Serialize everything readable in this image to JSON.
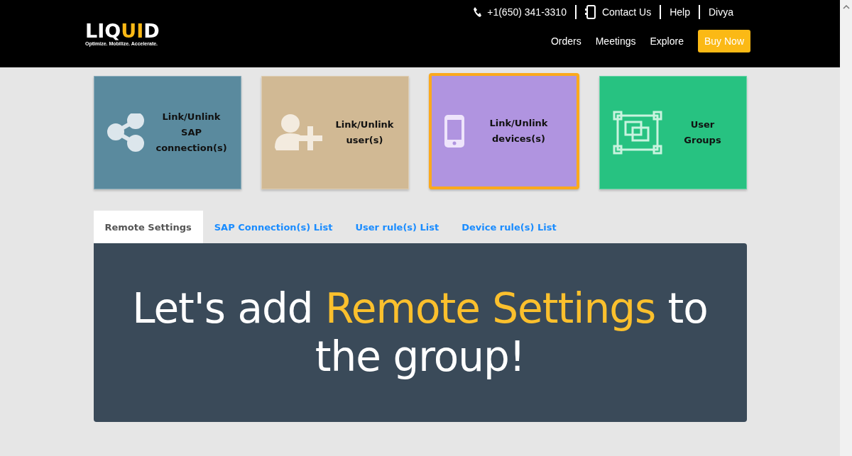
{
  "header": {
    "logo": {
      "word_start": "LIQ",
      "word_accent": "UI",
      "word_end": "D",
      "tagline": "Optimize. Mobilize. Accelerate."
    },
    "top_links": [
      {
        "kind": "phone",
        "label": "+1(650) 341-3310"
      },
      {
        "kind": "contact",
        "label": "Contact Us"
      },
      {
        "kind": "plain",
        "label": "Help"
      },
      {
        "kind": "plain",
        "label": "Divya"
      }
    ],
    "nav": [
      {
        "label": "Orders",
        "kind": "link"
      },
      {
        "label": "Meetings",
        "kind": "link"
      },
      {
        "label": "Explore",
        "kind": "link"
      },
      {
        "label": "Buy Now",
        "kind": "button"
      }
    ]
  },
  "tiles": [
    {
      "kind": "share",
      "label": "Link/Unlink SAP connection(s)",
      "color": "#5a8a9e",
      "selected": false
    },
    {
      "kind": "user-add",
      "label": "Link/Unlink user(s)",
      "color": "#d1b994",
      "selected": false
    },
    {
      "kind": "phone",
      "label": "Link/Unlink devices(s)",
      "color": "#b094e0",
      "selected": true
    },
    {
      "kind": "group",
      "label": "User Groups",
      "color": "#27c281",
      "selected": false
    }
  ],
  "tabs": [
    {
      "label": "Remote Settings",
      "selected": true
    },
    {
      "label": "SAP Connection(s) List",
      "selected": false
    },
    {
      "label": "User rule(s) List",
      "selected": false
    },
    {
      "label": "Device rule(s) List",
      "selected": false
    }
  ],
  "hero": {
    "parts": [
      {
        "text": "Let's add ",
        "highlight": false
      },
      {
        "text": "Remote Settings",
        "highlight": true
      },
      {
        "text": " to the group!",
        "highlight": false
      }
    ]
  }
}
